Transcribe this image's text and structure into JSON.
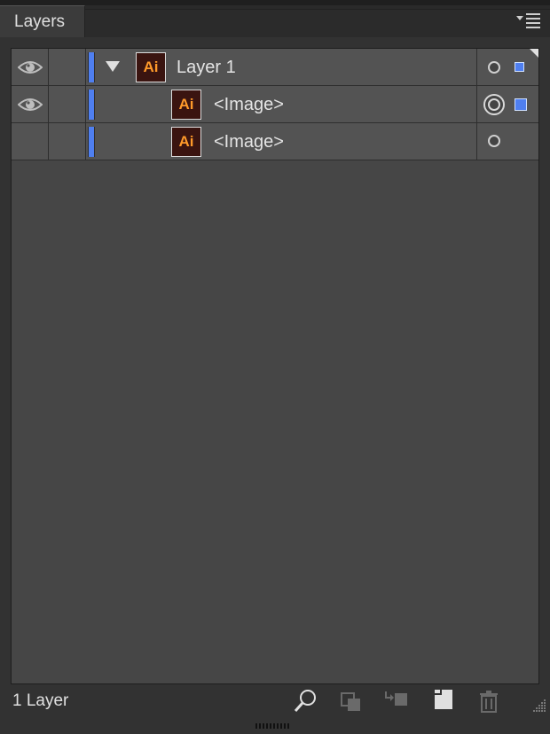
{
  "panel": {
    "tab_label": "Layers",
    "menu_icon": "panel-menu-icon"
  },
  "layers": [
    {
      "name": "Layer 1",
      "type": "layer",
      "visible": true,
      "expanded": true,
      "thumb_text": "Ai",
      "color": "#4f7ff0",
      "selected_art": true
    },
    {
      "name": "<Image>",
      "type": "item",
      "visible": true,
      "thumb_text": "Ai",
      "color": "#4f7ff0",
      "targeted": true,
      "selected": true
    },
    {
      "name": "<Image>",
      "type": "item",
      "visible": false,
      "thumb_text": "Ai",
      "color": "#4f7ff0",
      "targeted": false,
      "selected": false
    }
  ],
  "footer": {
    "count_label": "1 Layer",
    "buttons": [
      "locate-object-icon",
      "make-clipping-mask-icon",
      "create-sublayer-icon",
      "create-new-layer-icon",
      "delete-layer-icon"
    ]
  },
  "colors": {
    "layer_color": "#4f7ff0",
    "ai_orange": "#ff9a2a",
    "ai_bg": "#3a1410"
  }
}
